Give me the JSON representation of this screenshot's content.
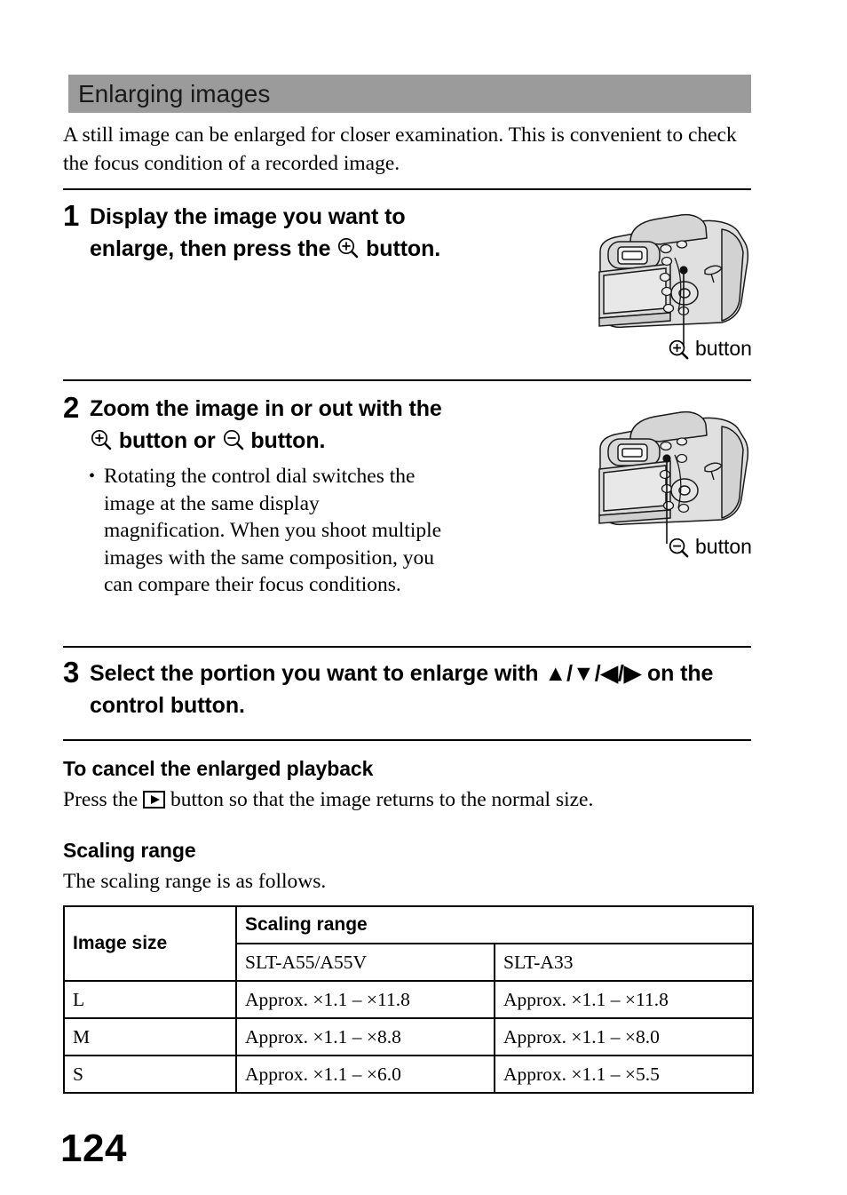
{
  "section": {
    "title": "Enlarging images"
  },
  "intro": "A still image can be enlarged for closer examination. This is convenient to check the focus condition of a recorded image.",
  "steps": [
    {
      "number": "1",
      "line1": "Display the image you want to",
      "line2_before": "enlarge, then press the",
      "icon": "magnifier-plus-icon",
      "line2_after": "button."
    },
    {
      "number": "2",
      "line1": "Zoom the image in or out with the",
      "icon_a": "magnifier-plus-icon",
      "line2_mid": "button or",
      "icon_b": "magnifier-minus-icon",
      "line2_after": "button.",
      "bullet": "Rotating the control dial switches the image at the same display magnification. When you shoot multiple images with the same composition, you can compare their focus conditions."
    },
    {
      "number": "3",
      "line1_before": "Select the portion you want to enlarge with",
      "arrows": "▲/▼/◀/▶",
      "line1_after": "on the",
      "line2": "control button."
    }
  ],
  "figures": [
    {
      "name": "camera-rear-view",
      "caption_icon": "magnifier-plus-icon",
      "caption_text": "button"
    },
    {
      "name": "camera-rear-view",
      "caption_icon": "magnifier-minus-icon",
      "caption_text": "button"
    }
  ],
  "cancel_section": {
    "heading": "To cancel the enlarged playback",
    "text_before": "Press the",
    "icon": "playback-button-icon",
    "text_after": "button so that the image returns to the normal size."
  },
  "scaling_section": {
    "heading": "Scaling range",
    "text": "The scaling range is as follows."
  },
  "table": {
    "header_image_size": "Image size",
    "header_scaling_range": "Scaling range",
    "header_col1": "SLT-A55/A55V",
    "header_col2": "SLT-A33",
    "rows": [
      {
        "size": "L",
        "a55": "Approx. ×1.1 – ×11.8",
        "a33": "Approx. ×1.1 – ×11.8"
      },
      {
        "size": "M",
        "a55": "Approx. ×1.1 – ×8.8",
        "a33": "Approx. ×1.1 – ×8.0"
      },
      {
        "size": "S",
        "a55": "Approx. ×1.1 – ×6.0",
        "a33": "Approx. ×1.1 – ×5.5"
      }
    ]
  },
  "page_number": "124",
  "colors": {
    "section_bar": "#9b9b9b",
    "text": "#000000",
    "camera_body": "#e3e3e3",
    "camera_shade": "#cfcfcf"
  }
}
